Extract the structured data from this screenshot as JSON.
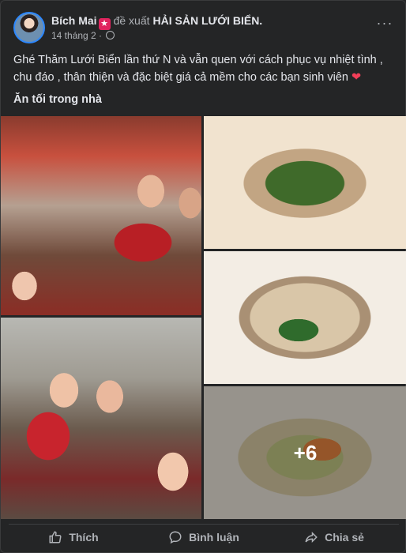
{
  "post": {
    "author": "Bích Mai",
    "verb": "đề xuất",
    "page_name": "HẢI SẢN LƯỚI BIỂN.",
    "date": "14 tháng 2 ·",
    "more_label": "···",
    "text": "Ghé Thăm Lưới Biển lần thứ N và vẫn quen với cách phục vụ nhiệt tình , chu đáo , thân thiện và đặc biệt giá cả mềm cho các bạn sinh viên",
    "heart": "❤",
    "checkin": "Ăn tối trong nhà"
  },
  "photos": {
    "more_count": "+6"
  },
  "actions": {
    "like": "Thích",
    "comment": "Bình luận",
    "share": "Chia sẻ"
  },
  "colors": {
    "background": "#242526",
    "text_primary": "#e4e6eb",
    "text_secondary": "#b0b3b8",
    "badge": "#e0245e"
  }
}
